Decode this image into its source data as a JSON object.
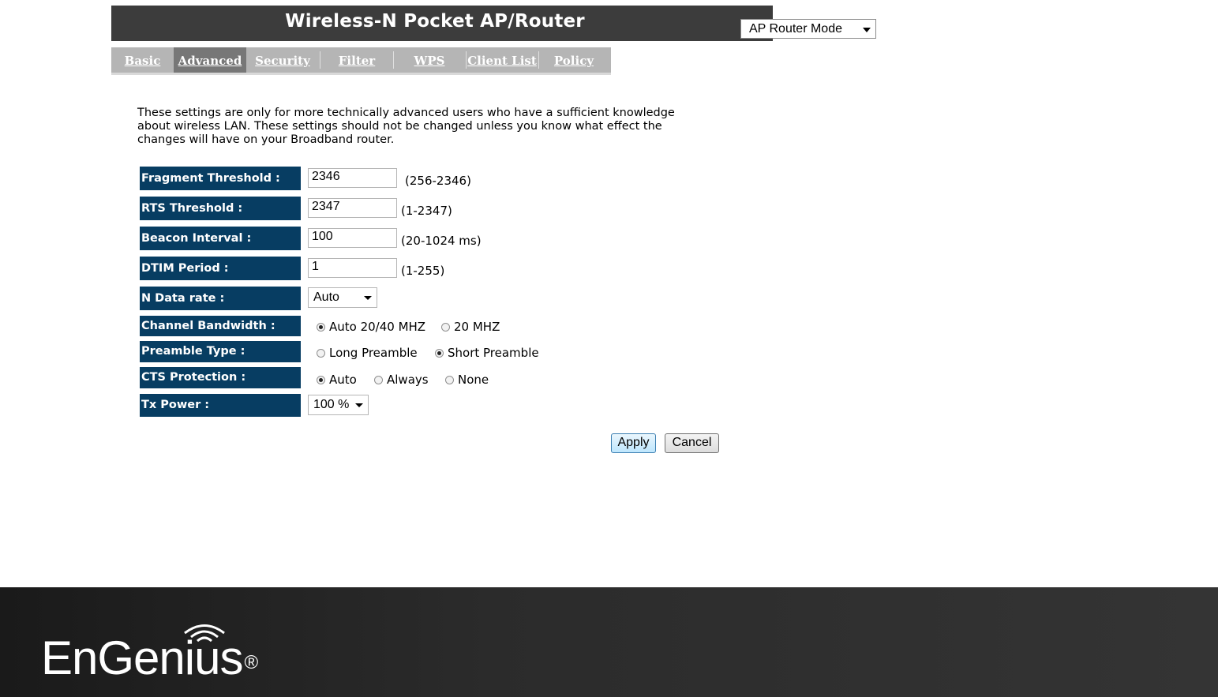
{
  "header": {
    "title": "Wireless-N Pocket AP/Router",
    "mode_select": "AP Router Mode"
  },
  "tabs": [
    {
      "label": "Basic",
      "active": false
    },
    {
      "label": "Advanced",
      "active": true
    },
    {
      "label": "Security",
      "active": false
    },
    {
      "label": "Filter",
      "active": false
    },
    {
      "label": "WPS",
      "active": false
    },
    {
      "label": "Client List",
      "active": false
    },
    {
      "label": "Policy",
      "active": false
    }
  ],
  "intro": "These settings are only for more technically advanced users who have a sufficient knowledge about wireless LAN. These settings should not be changed unless you know what effect the changes will have on your Broadband router.",
  "form": {
    "fragment": {
      "label": "Fragment Threshold :",
      "value": "2346",
      "hint": "(256-2346)"
    },
    "rts": {
      "label": "RTS Threshold :",
      "value": "2347",
      "hint": "(1-2347)"
    },
    "beacon": {
      "label": "Beacon Interval :",
      "value": "100",
      "hint": "(20-1024 ms)"
    },
    "dtim": {
      "label": "DTIM Period :",
      "value": "1",
      "hint": "(1-255)"
    },
    "ndata": {
      "label": "N Data rate :",
      "value": "Auto"
    },
    "bandwidth": {
      "label": "Channel Bandwidth :",
      "options": [
        "Auto 20/40 MHZ",
        "20 MHZ"
      ],
      "selected": "Auto 20/40 MHZ"
    },
    "preamble": {
      "label": "Preamble Type :",
      "options": [
        "Long Preamble",
        "Short Preamble"
      ],
      "selected": "Short Preamble"
    },
    "cts": {
      "label": "CTS Protection :",
      "options": [
        "Auto",
        "Always",
        "None"
      ],
      "selected": "Auto"
    },
    "txpower": {
      "label": "Tx Power :",
      "value": "100 %"
    }
  },
  "buttons": {
    "apply": "Apply",
    "cancel": "Cancel"
  },
  "footer": {
    "brand": "EnGenius",
    "reg_mark": "®"
  },
  "icons": [
    "dropdown-arrow-icon",
    "wifi-icon"
  ]
}
